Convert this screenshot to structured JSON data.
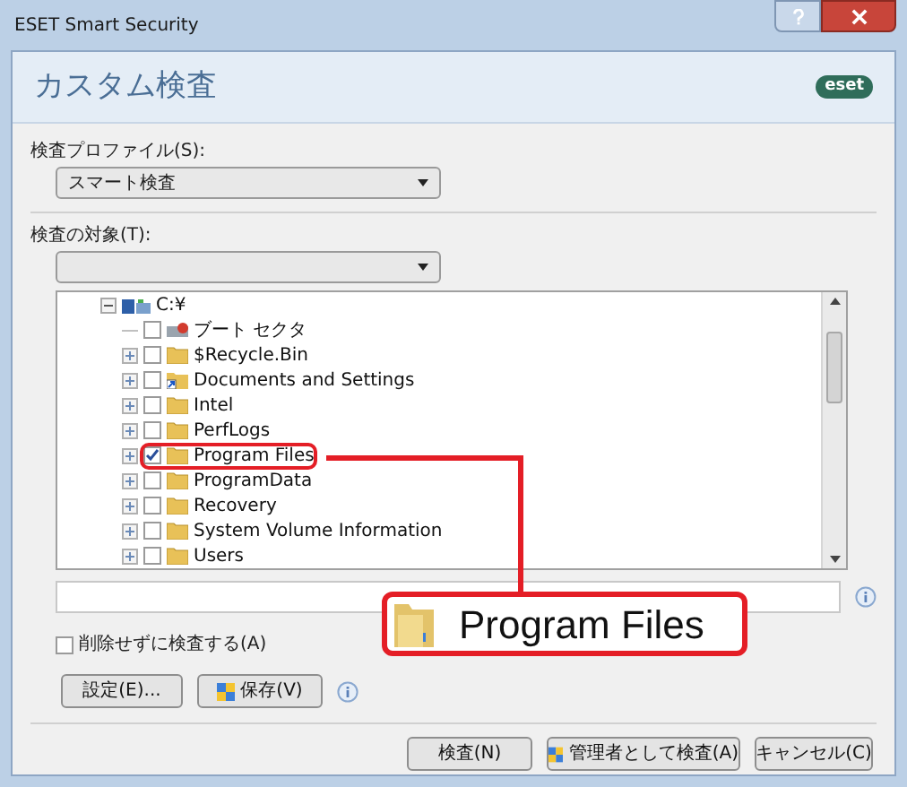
{
  "window": {
    "title": "ESET Smart Security"
  },
  "header": {
    "title": "カスタム検査",
    "logo": "eset"
  },
  "profile": {
    "label": "検査プロファイル(S):",
    "value": "スマート検査"
  },
  "targets": {
    "label": "検査の対象(T):"
  },
  "tree": {
    "label": "C:¥",
    "expanded": true,
    "children": [
      {
        "label": "ブート セクタ",
        "kind": "sector",
        "checked": false,
        "highlighted": false
      },
      {
        "label": "$Recycle.Bin",
        "kind": "folder",
        "checked": false,
        "highlighted": false
      },
      {
        "label": "Documents and Settings",
        "kind": "shortcut",
        "checked": false,
        "highlighted": false
      },
      {
        "label": "Intel",
        "kind": "folder",
        "checked": false,
        "highlighted": false
      },
      {
        "label": "PerfLogs",
        "kind": "folder",
        "checked": false,
        "highlighted": false
      },
      {
        "label": "Program Files",
        "kind": "folder",
        "checked": true,
        "highlighted": true
      },
      {
        "label": "ProgramData",
        "kind": "folder",
        "checked": false,
        "highlighted": false
      },
      {
        "label": "Recovery",
        "kind": "folder",
        "checked": false,
        "highlighted": false
      },
      {
        "label": "System Volume Information",
        "kind": "folder",
        "checked": false,
        "highlighted": false
      },
      {
        "label": "Users",
        "kind": "folder",
        "checked": false,
        "highlighted": false
      }
    ]
  },
  "callout": {
    "label": "Program Files"
  },
  "scan_option": {
    "label": "削除せずに検査する(A)",
    "checked": false
  },
  "buttons_left": [
    {
      "label": "設定(E)...",
      "shield": false
    },
    {
      "label": "保存(V)",
      "shield": true
    }
  ],
  "buttons_bottom": [
    {
      "label": "検査(N)",
      "shield": false
    },
    {
      "label": "管理者として検査(A)",
      "shield": true
    },
    {
      "label": "キャンセル(C)",
      "shield": false
    }
  ]
}
